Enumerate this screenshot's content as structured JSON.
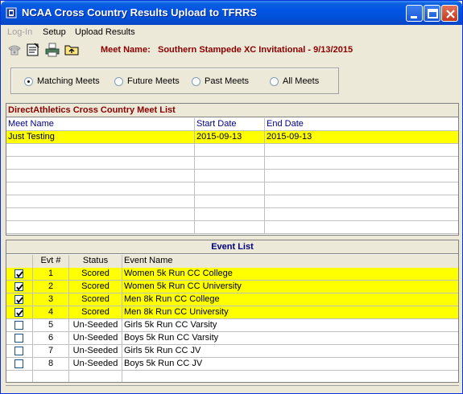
{
  "window": {
    "title": "NCAA Cross Country Results Upload to TFRRS"
  },
  "menu": {
    "items": [
      {
        "label": "Log-In",
        "enabled": false
      },
      {
        "label": "Setup",
        "enabled": true
      },
      {
        "label": "Upload Results",
        "enabled": true
      }
    ]
  },
  "toolbar": {
    "icons": [
      "phone-icon",
      "notepad-icon",
      "printer-icon",
      "folder-up-icon"
    ],
    "meet_label": "Meet Name:",
    "meet_value": "Southern Stampede XC Invitational - 9/13/2015"
  },
  "filter": {
    "options": [
      "Matching Meets",
      "Future Meets",
      "Past Meets",
      "All Meets"
    ],
    "selected": "Matching Meets"
  },
  "meet_list": {
    "title": "DirectAthletics Cross Country Meet List",
    "columns": [
      "Meet Name",
      "Start Date",
      "End Date"
    ],
    "rows": [
      {
        "name": "Just Testing",
        "start": "2015-09-13",
        "end": "2015-09-13",
        "selected": true
      }
    ]
  },
  "event_list": {
    "title": "Event List",
    "columns": [
      "",
      "Evt #",
      "Status",
      "Event Name"
    ],
    "rows": [
      {
        "checked": true,
        "num": "1",
        "status": "Scored",
        "name": "Women 5k Run CC College",
        "highlight": true
      },
      {
        "checked": true,
        "num": "2",
        "status": "Scored",
        "name": "Women 5k Run CC University",
        "highlight": true
      },
      {
        "checked": true,
        "num": "3",
        "status": "Scored",
        "name": "Men 8k Run CC College",
        "highlight": true
      },
      {
        "checked": true,
        "num": "4",
        "status": "Scored",
        "name": "Men 8k Run CC University",
        "highlight": true
      },
      {
        "checked": false,
        "num": "5",
        "status": "Un-Seeded",
        "name": "Girls 5k Run CC Varsity",
        "highlight": false
      },
      {
        "checked": false,
        "num": "6",
        "status": "Un-Seeded",
        "name": "Boys 5k Run CC Varsity",
        "highlight": false
      },
      {
        "checked": false,
        "num": "7",
        "status": "Un-Seeded",
        "name": "Girls 5k Run CC JV",
        "highlight": false
      },
      {
        "checked": false,
        "num": "8",
        "status": "Un-Seeded",
        "name": "Boys 5k Run CC JV",
        "highlight": false
      }
    ]
  },
  "colors": {
    "titlebar": "#0054e3",
    "highlight": "#ffff00",
    "meet_name_text": "#8b0000",
    "column_header_text": "#000080"
  }
}
